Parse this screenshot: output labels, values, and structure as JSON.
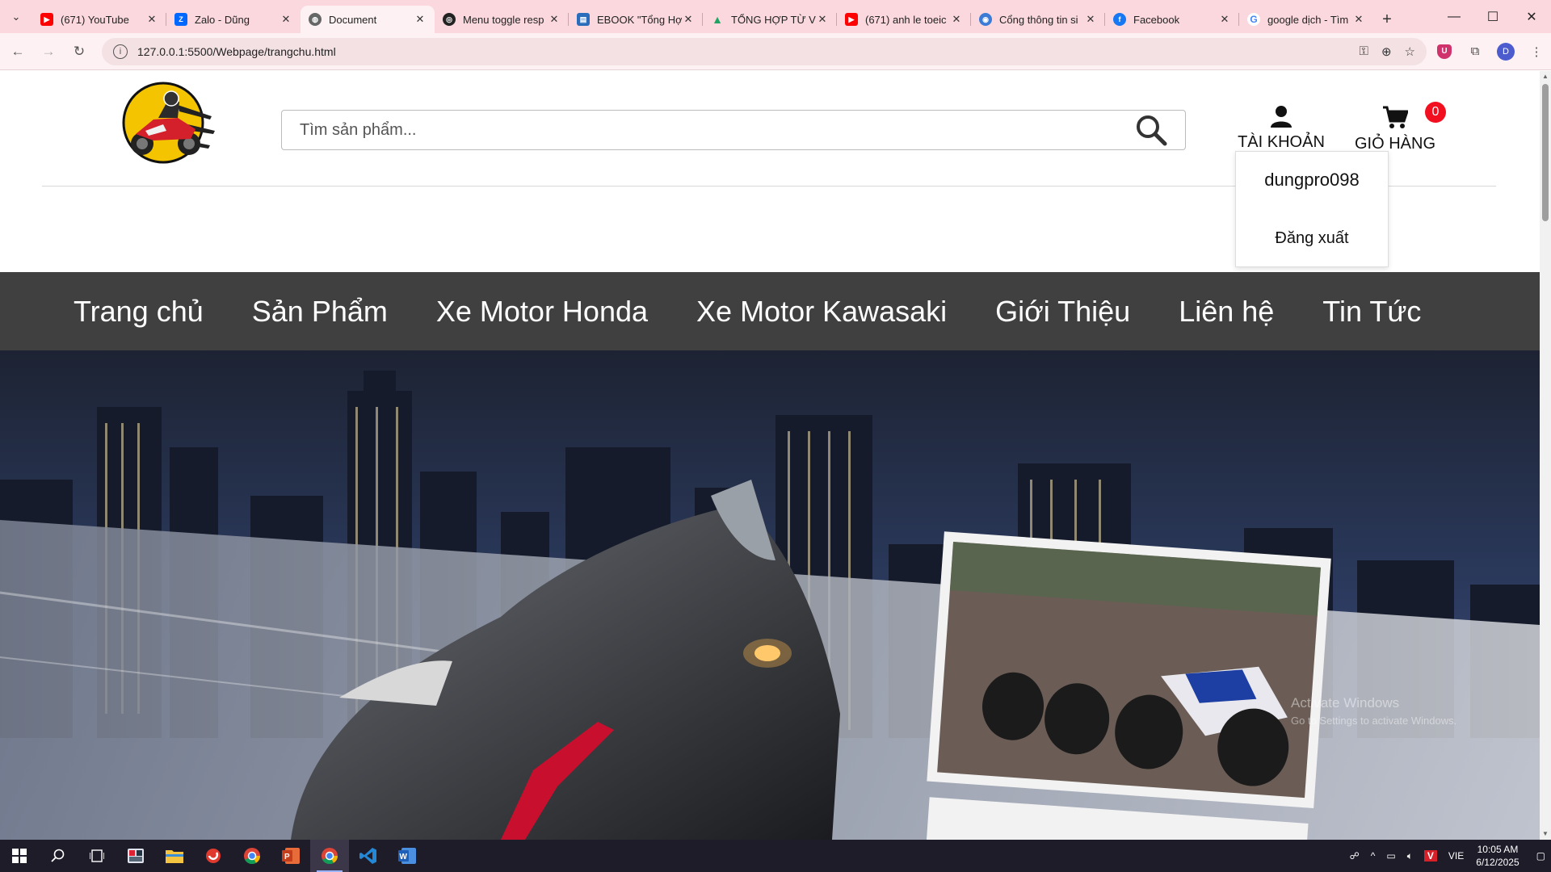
{
  "browser": {
    "tabs": [
      {
        "label": "(671) YouTube",
        "icon": "youtube-icon",
        "color": "#ff0000"
      },
      {
        "label": "Zalo - Dũng",
        "icon": "zalo-icon",
        "color": "#0068ff"
      },
      {
        "label": "Document",
        "icon": "globe-icon",
        "color": "#555555",
        "active": true
      },
      {
        "label": "Menu toggle resp",
        "icon": "codepen-icon",
        "color": "#222222"
      },
      {
        "label": "EBOOK \"Tổng Hợ",
        "icon": "ebook-icon",
        "color": "#2a6ebb"
      },
      {
        "label": "TỔNG HỢP TỪ VỰ",
        "icon": "google-drive-icon",
        "color": "#1fa463"
      },
      {
        "label": "(671) anh le toeic",
        "icon": "youtube-icon",
        "color": "#ff0000"
      },
      {
        "label": "Cổng thông tin si",
        "icon": "portal-icon",
        "color": "#3c7bd6"
      },
      {
        "label": "Facebook",
        "icon": "facebook-icon",
        "color": "#1877f2"
      },
      {
        "label": "google dịch - Tìm",
        "icon": "google-icon",
        "color": "#4285f4"
      }
    ],
    "url": "127.0.0.1:5500/Webpage/trangchu.html",
    "profile_initial": "D"
  },
  "site": {
    "search_placeholder": "Tìm sản phẩm...",
    "account_label": "TÀI KHOẢN",
    "cart_label": "GIỎ HÀNG",
    "cart_count": "0",
    "dropdown": {
      "username": "dungpro098",
      "logout": "Đăng xuất"
    },
    "nav": [
      "Trang chủ",
      "Sản Phẩm",
      "Xe Motor Honda",
      "Xe Motor Kawasaki",
      "Giới Thiệu",
      "Liên hệ",
      "Tin Tức"
    ],
    "watermark_line1": "Activate Windows",
    "watermark_line2": "Go to Settings to activate Windows."
  },
  "taskbar": {
    "language": "VIE",
    "time": "10:05 AM",
    "date": "6/12/2025"
  },
  "colors": {
    "tabbar_bg": "#fbd8de",
    "nav_bg": "#404040",
    "badge": "#f20f1f",
    "taskbar_bg": "#1f1c2a"
  }
}
